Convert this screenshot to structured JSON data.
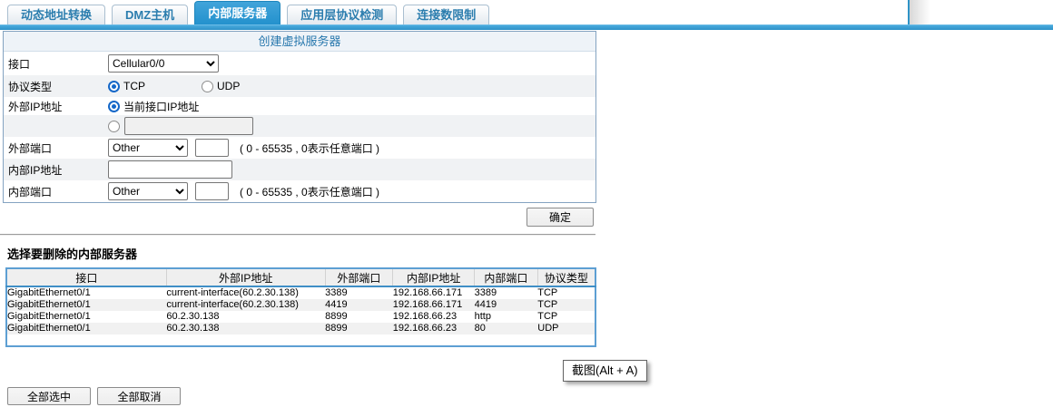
{
  "tabs": [
    {
      "label": "动态地址转换",
      "active": false
    },
    {
      "label": "DMZ主机",
      "active": false
    },
    {
      "label": "内部服务器",
      "active": true
    },
    {
      "label": "应用层协议检测",
      "active": false
    },
    {
      "label": "连接数限制",
      "active": false
    }
  ],
  "form": {
    "title": "创建虚拟服务器",
    "interface_label": "接口",
    "interface_value": "Cellular0/0",
    "protocol_label": "协议类型",
    "protocol_options": [
      "TCP",
      "UDP"
    ],
    "protocol_selected": "TCP",
    "external_ip_label": "外部IP地址",
    "external_ip_current_option": "当前接口IP地址",
    "external_ip_custom_value": "",
    "external_port_label": "外部端口",
    "external_port_select": "Other",
    "external_port_value": "",
    "port_hint": "( 0 - 65535 , 0表示任意端口 )",
    "internal_ip_label": "内部IP地址",
    "internal_ip_value": "",
    "internal_port_label": "内部端口",
    "internal_port_select": "Other",
    "internal_port_value": "",
    "ok_button": "确定"
  },
  "delete_section": {
    "title": "选择要删除的内部服务器",
    "table": {
      "headers": [
        "接口",
        "外部IP地址",
        "外部端口",
        "内部IP地址",
        "内部端口",
        "协议类型"
      ],
      "rows": [
        [
          "GigabitEthernet0/1",
          "current-interface(60.2.30.138)",
          "3389",
          "192.168.66.171",
          "3389",
          "TCP"
        ],
        [
          "GigabitEthernet0/1",
          "current-interface(60.2.30.138)",
          "4419",
          "192.168.66.171",
          "4419",
          "TCP"
        ],
        [
          "GigabitEthernet0/1",
          "60.2.30.138",
          "8899",
          "192.168.66.23",
          "http",
          "TCP"
        ],
        [
          "GigabitEthernet0/1",
          "60.2.30.138",
          "8899",
          "192.168.66.23",
          "80",
          "UDP"
        ]
      ]
    },
    "select_all_button": "全部选中",
    "deselect_all_button": "全部取消"
  },
  "tooltip": {
    "text": "截图(Alt + A)"
  },
  "colors": {
    "accent_blue": "#2d92c8",
    "active_tab_blue": "#2391cd",
    "panel_border": "#84a3c1",
    "header_text_blue": "#2878ad",
    "table_border_blue": "#5d9fd3",
    "radio_blue": "#1467c8"
  }
}
